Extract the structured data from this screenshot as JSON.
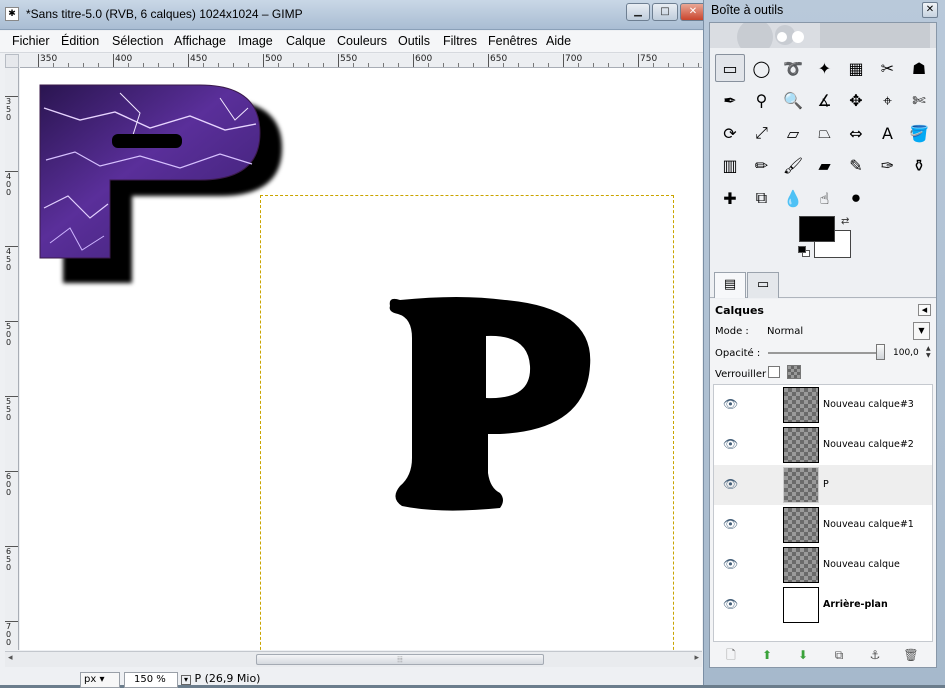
{
  "main_window": {
    "title": "*Sans titre-5.0 (RVB, 6 calques) 1024x1024 – GIMP",
    "buttons": {
      "minimize": "▁",
      "maximize": "□",
      "close": "✕"
    }
  },
  "menu": [
    "Fichier",
    "Édition",
    "Sélection",
    "Affichage",
    "Image",
    "Calque",
    "Couleurs",
    "Outils",
    "Filtres",
    "Fenêtres",
    "Aide"
  ],
  "ruler_h_labels": [
    "350",
    "400",
    "450",
    "500",
    "550",
    "600",
    "650",
    "700",
    "750"
  ],
  "ruler_v_labels": [
    "350",
    "400",
    "450",
    "500",
    "550",
    "600",
    "650",
    "700"
  ],
  "canvas": {
    "letter": "P"
  },
  "statusbar": {
    "unit": "px",
    "zoom": "150 %",
    "status": "P (26,9 Mio)"
  },
  "toolbox": {
    "title": "Boîte à outils",
    "close": "✕",
    "tools": [
      {
        "name": "rect-select",
        "glyph": "▭"
      },
      {
        "name": "ellipse-select",
        "glyph": "◯"
      },
      {
        "name": "free-select",
        "glyph": "➰"
      },
      {
        "name": "fuzzy-select",
        "glyph": "✦"
      },
      {
        "name": "color-select",
        "glyph": "▦"
      },
      {
        "name": "scissors",
        "glyph": "✂"
      },
      {
        "name": "foreground-select",
        "glyph": "☗"
      },
      {
        "name": "paths",
        "glyph": "✒"
      },
      {
        "name": "color-picker",
        "glyph": "⚲"
      },
      {
        "name": "zoom",
        "glyph": "🔍"
      },
      {
        "name": "measure",
        "glyph": "∡"
      },
      {
        "name": "move",
        "glyph": "✥"
      },
      {
        "name": "align",
        "glyph": "⌖"
      },
      {
        "name": "crop",
        "glyph": "✄"
      },
      {
        "name": "rotate",
        "glyph": "⟳"
      },
      {
        "name": "scale",
        "glyph": "⤢"
      },
      {
        "name": "shear",
        "glyph": "▱"
      },
      {
        "name": "perspective",
        "glyph": "⏢"
      },
      {
        "name": "flip",
        "glyph": "⇔"
      },
      {
        "name": "text",
        "glyph": "A"
      },
      {
        "name": "bucket-fill",
        "glyph": "🪣"
      },
      {
        "name": "blend",
        "glyph": "▥"
      },
      {
        "name": "pencil",
        "glyph": "✏"
      },
      {
        "name": "paintbrush",
        "glyph": "🖌"
      },
      {
        "name": "eraser",
        "glyph": "▰"
      },
      {
        "name": "airbrush",
        "glyph": "✎"
      },
      {
        "name": "ink",
        "glyph": "✑"
      },
      {
        "name": "clone",
        "glyph": "⚱"
      },
      {
        "name": "heal",
        "glyph": "✚"
      },
      {
        "name": "perspective-clone",
        "glyph": "⧉"
      },
      {
        "name": "blur",
        "glyph": "💧"
      },
      {
        "name": "smudge",
        "glyph": "☝"
      },
      {
        "name": "dodge-burn",
        "glyph": "⚫"
      }
    ],
    "colors": {
      "foreground": "#000000",
      "background": "#ffffff"
    }
  },
  "layers_panel": {
    "title": "Calques",
    "mode_label": "Mode :",
    "mode_value": "Normal",
    "opacity_label": "Opacité :",
    "opacity_value": "100,0",
    "opacity_fraction": 1.0,
    "lock_label": "Verrouiller :",
    "layers": [
      {
        "name": "Nouveau calque#3",
        "bold": false,
        "selected": false,
        "thumb": "checker"
      },
      {
        "name": "Nouveau calque#2",
        "bold": false,
        "selected": false,
        "thumb": "checker"
      },
      {
        "name": "P",
        "bold": false,
        "selected": true,
        "thumb": "checker-nob"
      },
      {
        "name": "Nouveau calque#1",
        "bold": false,
        "selected": false,
        "thumb": "checker"
      },
      {
        "name": "Nouveau calque",
        "bold": false,
        "selected": false,
        "thumb": "checker"
      },
      {
        "name": "Arrière-plan",
        "bold": true,
        "selected": false,
        "thumb": "white"
      }
    ],
    "actions": [
      {
        "name": "new-layer",
        "glyph": "🗋",
        "color": "#777"
      },
      {
        "name": "raise-layer",
        "glyph": "⬆",
        "color": "#3aa23a"
      },
      {
        "name": "lower-layer",
        "glyph": "⬇",
        "color": "#3aa23a"
      },
      {
        "name": "duplicate-layer",
        "glyph": "⧉",
        "color": "#555"
      },
      {
        "name": "anchor-layer",
        "glyph": "⚓",
        "color": "#555"
      },
      {
        "name": "delete-layer",
        "glyph": "🗑",
        "color": "#555"
      }
    ]
  },
  "colors": {
    "title_bar": "#b9c9da",
    "selection_boundary": "#c9a400",
    "lightning_purple": "#4a2a80"
  }
}
